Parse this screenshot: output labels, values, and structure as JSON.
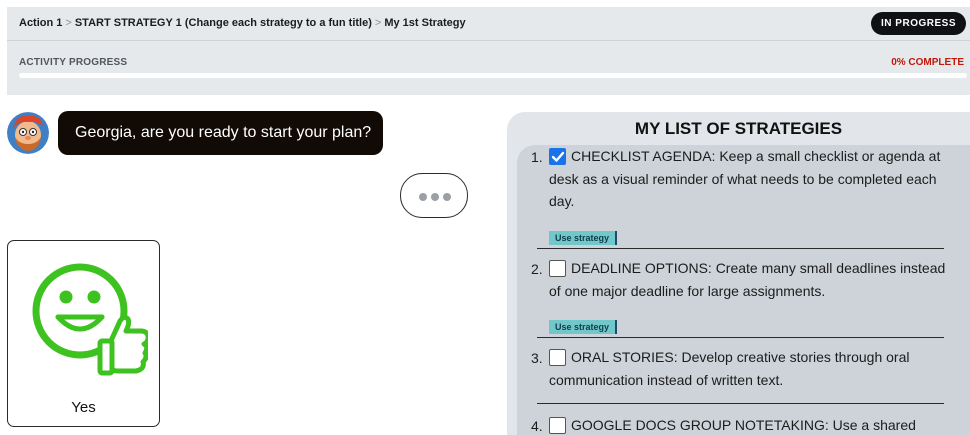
{
  "header": {
    "breadcrumb": {
      "item1": "Action 1",
      "sep1": ">",
      "item2": "START STRATEGY 1 (Change each strategy to a fun title)",
      "sep2": ">",
      "item3": "My 1st Strategy"
    },
    "status_badge": "IN PROGRESS"
  },
  "progress": {
    "label": "ACTIVITY PROGRESS",
    "percent_text": "0% COMPLETE",
    "value": 0
  },
  "chat": {
    "message": "Georgia, are you ready to start your plan?",
    "typing_indicator": "typing",
    "response_option": {
      "label": "Yes",
      "icon": "smiley-thumbs-up-icon"
    }
  },
  "strategies": {
    "title": "MY LIST OF STRATEGIES",
    "use_label": "Use strategy",
    "items": [
      {
        "number": "1.",
        "checked": true,
        "text": "CHECKLIST AGENDA: Keep a small checklist or agenda at desk as a visual reminder of what needs to be completed each day."
      },
      {
        "number": "2.",
        "checked": false,
        "text": "DEADLINE OPTIONS: Create many small deadlines instead of one major deadline for large assignments."
      },
      {
        "number": "3.",
        "checked": false,
        "text": "ORAL STORIES: Develop creative stories through oral communication instead of written text."
      },
      {
        "number": "4.",
        "checked": false,
        "text": "GOOGLE DOCS GROUP NOTETAKING: Use a shared"
      }
    ]
  },
  "colors": {
    "status_badge_bg": "#0f1115",
    "percent_red": "#c0180b",
    "bubble_bg": "#110a05",
    "icon_green": "#3ec21f",
    "use_button_bg": "#72c7cb",
    "checkbox_blue": "#1a73e8"
  }
}
